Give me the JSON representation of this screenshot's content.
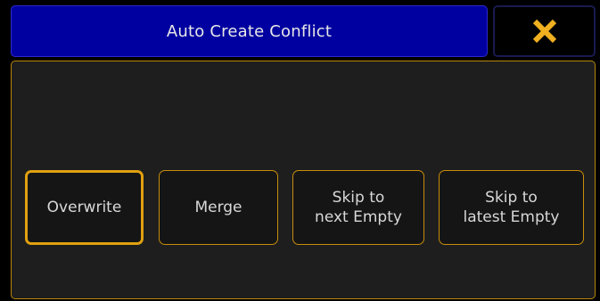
{
  "dialog": {
    "title": "Auto Create Conflict",
    "close_icon": "close-x-icon",
    "colors": {
      "title_bar": "#0000a0",
      "close_icon": "#f0b020",
      "accent_border": "#c88c0c",
      "panel_bg": "#1e1e1e"
    }
  },
  "options": {
    "overwrite": "Overwrite",
    "merge": "Merge",
    "skip_next": "Skip to\nnext Empty",
    "skip_latest": "Skip to\nlatest Empty"
  },
  "selected_option": "Overwrite"
}
